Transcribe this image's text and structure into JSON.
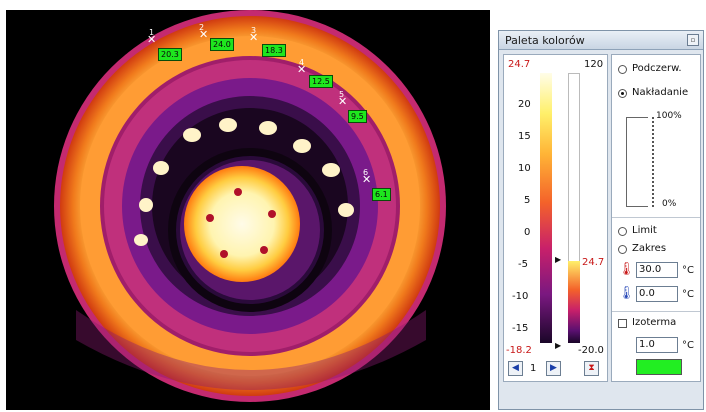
{
  "markers": [
    {
      "num": "1",
      "value": "20.3"
    },
    {
      "num": "2",
      "value": "24.0"
    },
    {
      "num": "3",
      "value": "18.3"
    },
    {
      "num": "4",
      "value": "12.5"
    },
    {
      "num": "5",
      "value": "9.5"
    },
    {
      "num": "6",
      "value": "6.1"
    }
  ],
  "panel": {
    "title": "Paleta kolorów",
    "scale": {
      "top_value": "24.7",
      "right_top_value": "120",
      "ticks": [
        "20",
        "15",
        "10",
        "5",
        "0",
        "-5",
        "-10",
        "-15"
      ],
      "bottom_value": "-18.2",
      "right_bottom_value": "-20.0",
      "indicator_value": "24.7"
    },
    "options": {
      "podczerw_label": "Podczerw.",
      "nakladanie_label": "Nakładanie",
      "pct_top": "100%",
      "pct_bottom": "0%",
      "limit_label": "Limit",
      "zakres_label": "Zakres",
      "upper_value": "30.0",
      "lower_value": "0.0",
      "unit": "°C",
      "izoterma_label": "Izoterma",
      "izoterma_value": "1.0",
      "izoterma_color": "#22ee22"
    },
    "nav": {
      "page": "1"
    }
  },
  "icons": {
    "prev": "left-arrow-icon",
    "next": "right-arrow-icon",
    "hourglass": "hourglass-icon",
    "thermo_hot": "thermometer-hot-icon",
    "thermo_cold": "thermometer-cold-icon"
  }
}
